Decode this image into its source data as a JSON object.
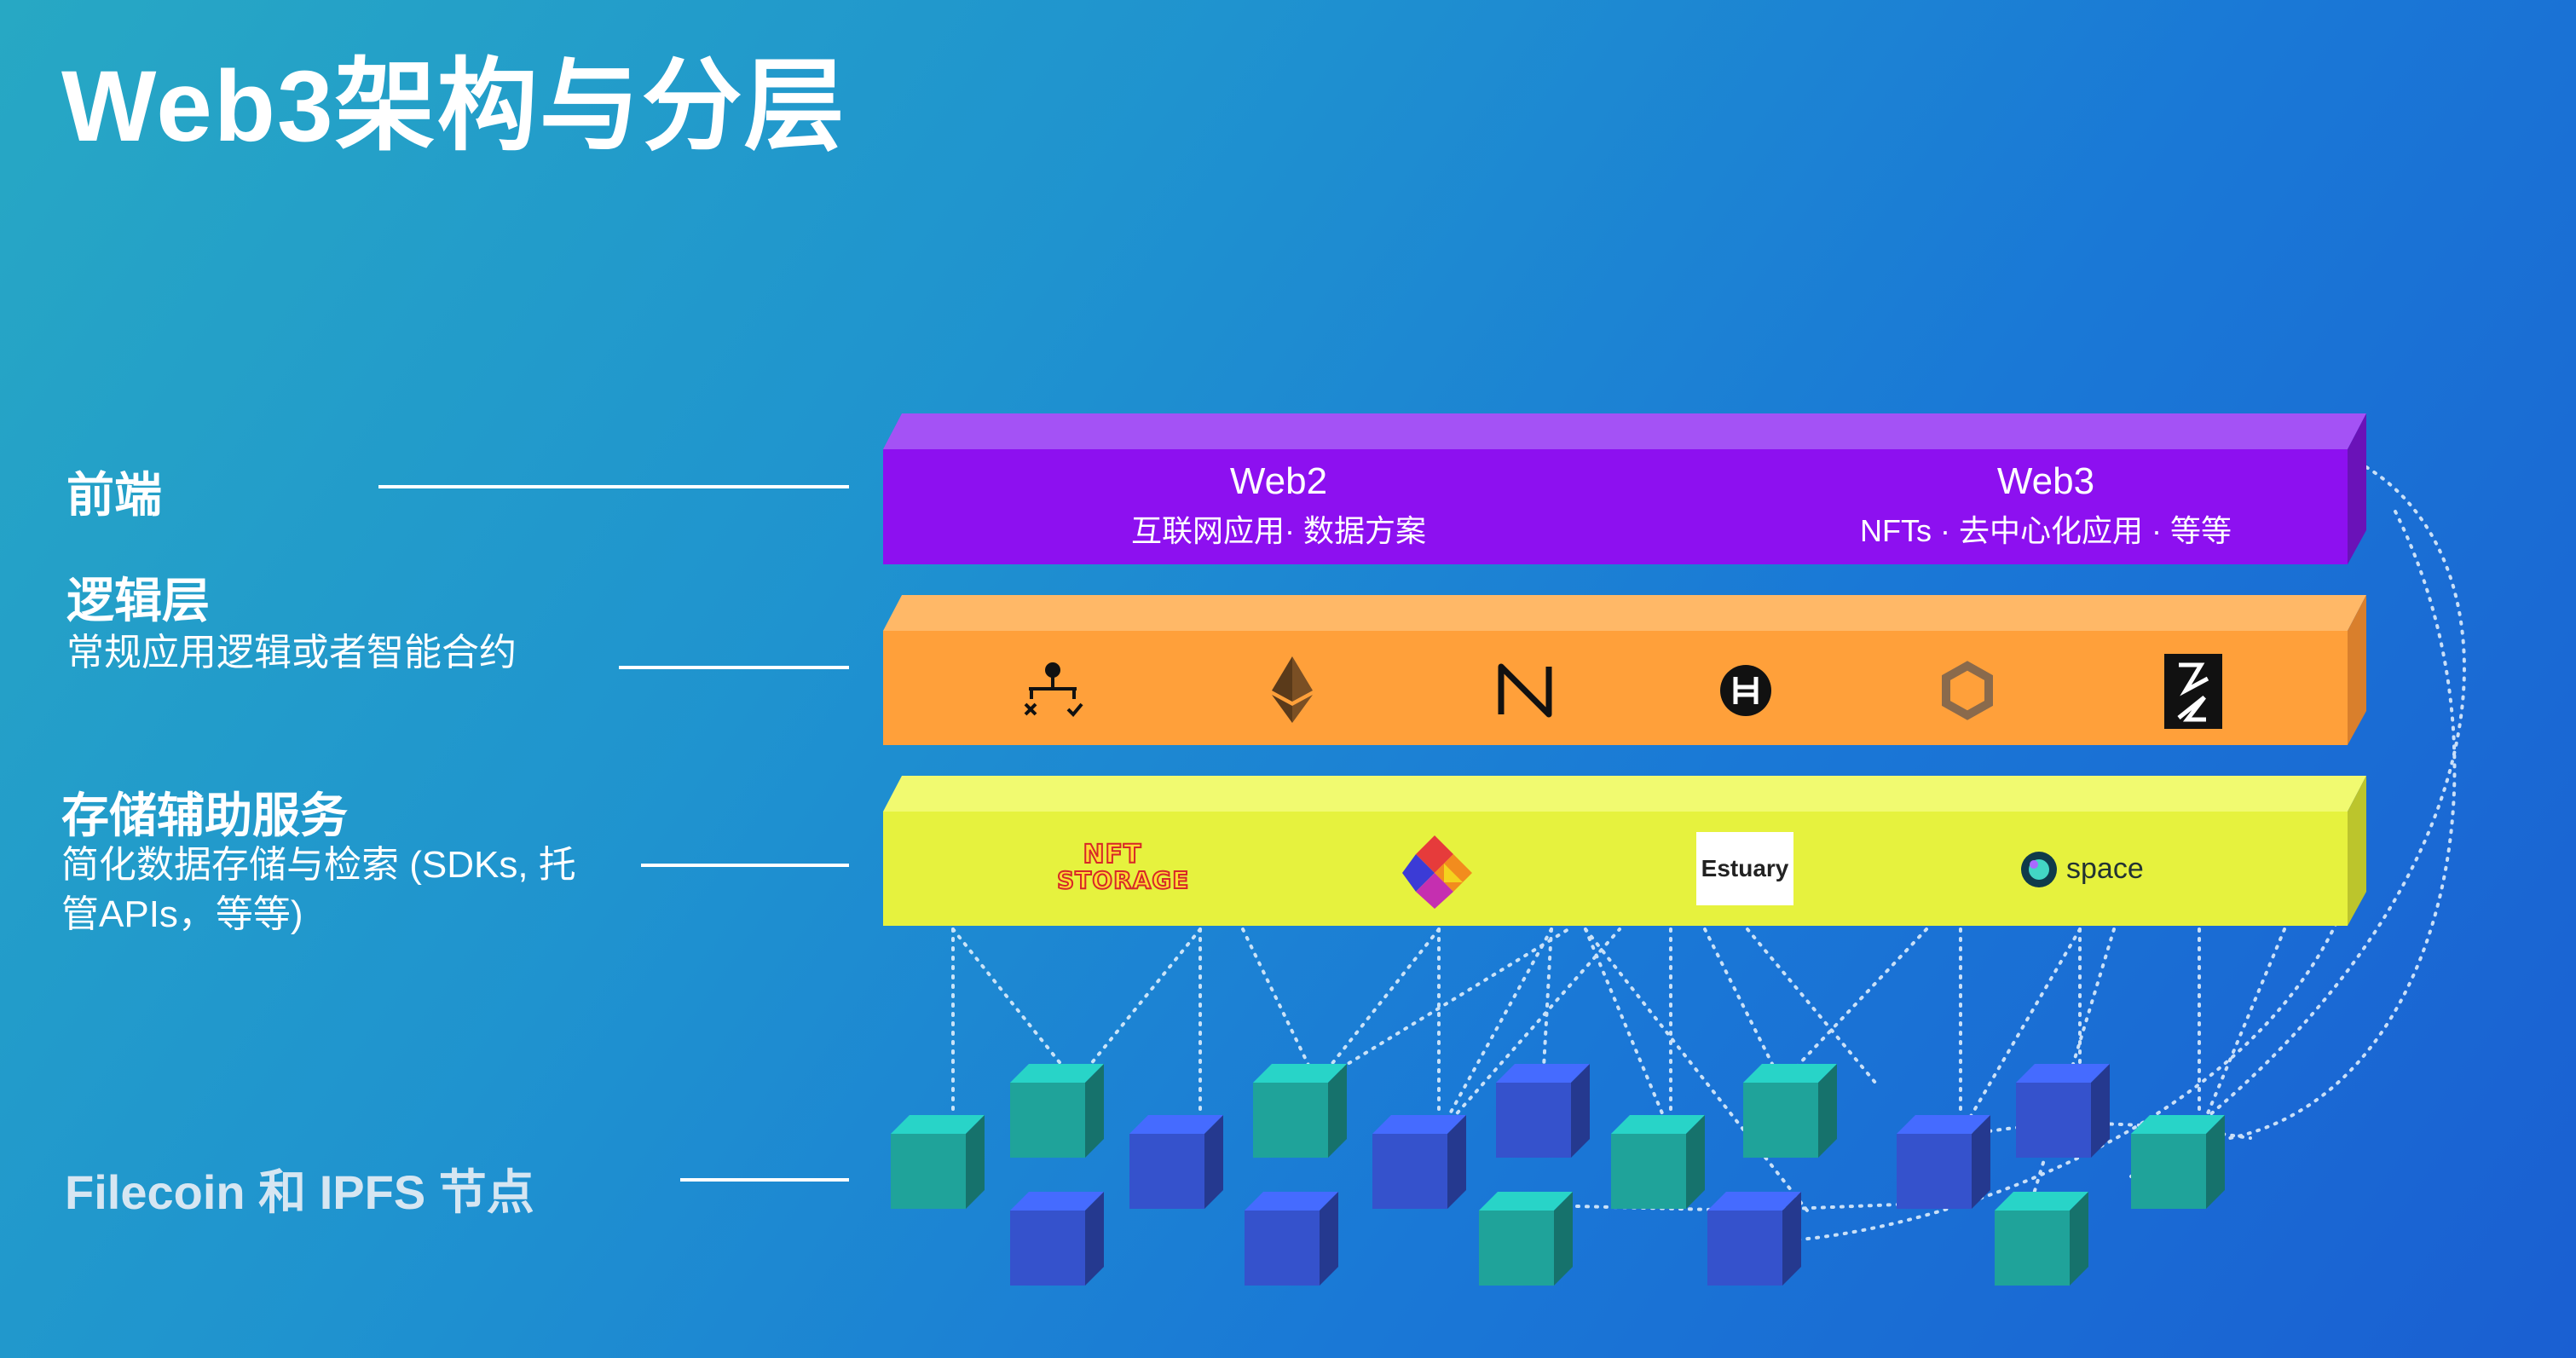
{
  "title": "Web3架构与分层",
  "labels": {
    "frontend": "前端",
    "logic": "逻辑层",
    "logic_sub": "常规应用逻辑或者智能合约",
    "storage": "存储辅助服务",
    "storage_sub_1": "简化数据存储与检索 (SDKs, 托",
    "storage_sub_2": "管APIs，等等)",
    "nodes": "Filecoin 和 IPFS 节点"
  },
  "frontend_band": {
    "web2_title": "Web2",
    "web2_sub": "互联网应用· 数据方案",
    "web3_title": "Web3",
    "web3_sub": "NFTs · 去中心化应用 · 等等"
  },
  "logic_icons": [
    "workflow-icon",
    "ethereum-icon",
    "near-icon",
    "hedera-icon",
    "chainlink-icon",
    "fleek-icon"
  ],
  "storage_logos": {
    "nft_storage_line1": "NFT",
    "nft_storage_line2": "STORAGE",
    "textile": "textile-logo",
    "estuary": "Estuary",
    "space": "space"
  },
  "colors": {
    "frontend": "#8d10f0",
    "logic": "#ffa03a",
    "storage": "#e6f23e",
    "node_teal": "#1fa39a",
    "node_blue": "#3552cc"
  }
}
